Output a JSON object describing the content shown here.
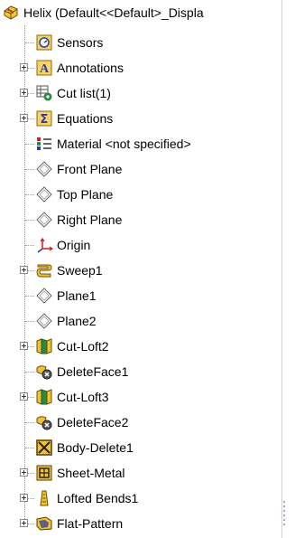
{
  "tree": {
    "root_label": "Helix  (Default<<Default>_Displa",
    "items": [
      {
        "label": "Sensors",
        "icon": "sensors-icon",
        "expandable": false
      },
      {
        "label": "Annotations",
        "icon": "annotations-icon",
        "expandable": true
      },
      {
        "label": "Cut list(1)",
        "icon": "cut-list-icon",
        "expandable": true
      },
      {
        "label": "Equations",
        "icon": "equations-icon",
        "expandable": true
      },
      {
        "label": "Material <not specified>",
        "icon": "material-icon",
        "expandable": false
      },
      {
        "label": "Front Plane",
        "icon": "plane-icon",
        "expandable": false
      },
      {
        "label": "Top Plane",
        "icon": "plane-icon",
        "expandable": false
      },
      {
        "label": "Right Plane",
        "icon": "plane-icon",
        "expandable": false
      },
      {
        "label": "Origin",
        "icon": "origin-icon",
        "expandable": false
      },
      {
        "label": "Sweep1",
        "icon": "sweep-icon",
        "expandable": true
      },
      {
        "label": "Plane1",
        "icon": "plane-icon",
        "expandable": false
      },
      {
        "label": "Plane2",
        "icon": "plane-icon",
        "expandable": false
      },
      {
        "label": "Cut-Loft2",
        "icon": "cut-loft-icon",
        "expandable": true
      },
      {
        "label": "DeleteFace1",
        "icon": "delete-face-icon",
        "expandable": false
      },
      {
        "label": "Cut-Loft3",
        "icon": "cut-loft-icon",
        "expandable": true
      },
      {
        "label": "DeleteFace2",
        "icon": "delete-face-icon",
        "expandable": false
      },
      {
        "label": "Body-Delete1",
        "icon": "body-delete-icon",
        "expandable": false
      },
      {
        "label": "Sheet-Metal",
        "icon": "sheet-metal-icon",
        "expandable": true
      },
      {
        "label": "Lofted Bends1",
        "icon": "lofted-bends-icon",
        "expandable": true
      },
      {
        "label": "Flat-Pattern",
        "icon": "flat-pattern-icon",
        "expandable": true
      }
    ]
  },
  "colors": {
    "tree_line": "#9a9a9a",
    "icon_yellow": "#f2c230",
    "icon_blue": "#2a3fa0",
    "icon_green": "#2b8a3e",
    "plane_gray": "#666666",
    "origin_red": "#cc2020"
  }
}
